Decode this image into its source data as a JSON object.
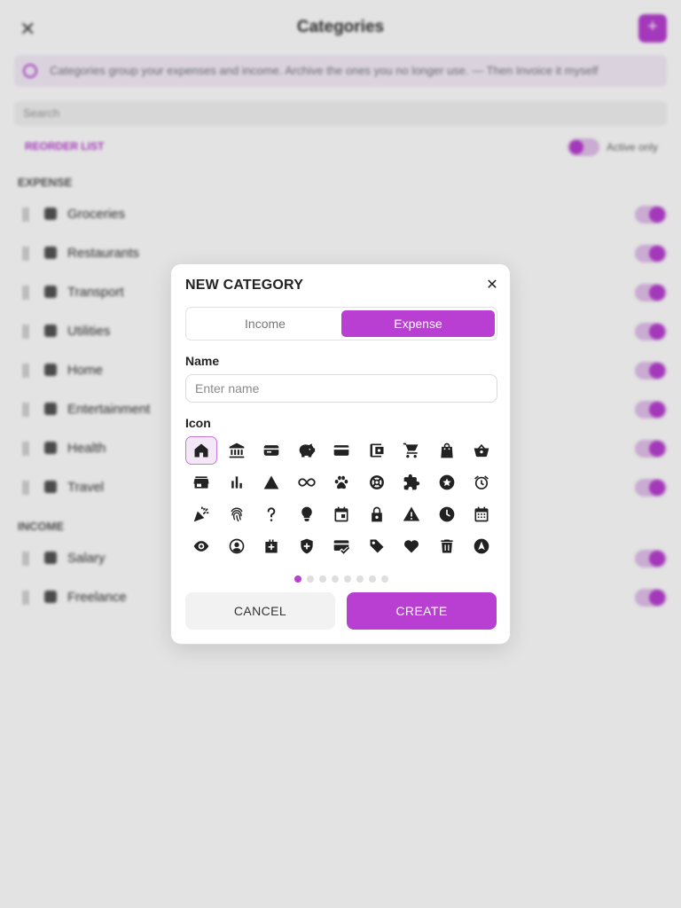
{
  "background": {
    "title": "Categories",
    "close_glyph": "✕",
    "info_text": "Categories group your expenses and income. Archive the ones you no longer use. — Then Invoice it myself",
    "search_placeholder": "Search",
    "reorder_label": "REORDER LIST",
    "active_only_label": "Active only",
    "sections": [
      {
        "title": "EXPENSE",
        "items": [
          "Groceries",
          "Restaurants",
          "Transport",
          "Utilities",
          "Home",
          "Entertainment",
          "Health",
          "Travel"
        ]
      },
      {
        "title": "INCOME",
        "items": [
          "Salary",
          "Freelance"
        ]
      }
    ]
  },
  "dialog": {
    "title": "NEW CATEGORY",
    "close_glyph": "✕",
    "type_options": {
      "income": "Income",
      "expense": "Expense"
    },
    "selected_type": "Expense",
    "name_label": "Name",
    "name_value": "",
    "name_placeholder": "Enter name",
    "icon_label": "Icon",
    "icons": [
      "home-icon",
      "bank-icon",
      "wallet-icon",
      "piggy-bank-icon",
      "credit-card-icon",
      "account-wallet-icon",
      "shopping-cart-icon",
      "shopping-bag-icon",
      "basket-icon",
      "store-icon",
      "bar-chart-icon",
      "triangle-icon",
      "infinity-icon",
      "paw-icon",
      "lifebuoy-icon",
      "puzzle-icon",
      "star-circle-icon",
      "alarm-icon",
      "party-popper-icon",
      "fingerprint-icon",
      "question-icon",
      "lightbulb-icon",
      "calendar-event-icon",
      "lock-icon",
      "warning-icon",
      "clock-icon",
      "calendar-grid-icon",
      "eye-icon",
      "account-circle-icon",
      "medical-bag-icon",
      "shield-plus-icon",
      "card-check-icon",
      "tag-icon",
      "heart-icon",
      "trash-icon",
      "navigation-icon"
    ],
    "selected_icon": "home-icon",
    "page_count": 8,
    "current_page": 1,
    "cancel_label": "CANCEL",
    "create_label": "CREATE"
  },
  "colors": {
    "accent": "#b93fd2",
    "accent_light": "#f4e8f8",
    "icon": "#222222"
  }
}
